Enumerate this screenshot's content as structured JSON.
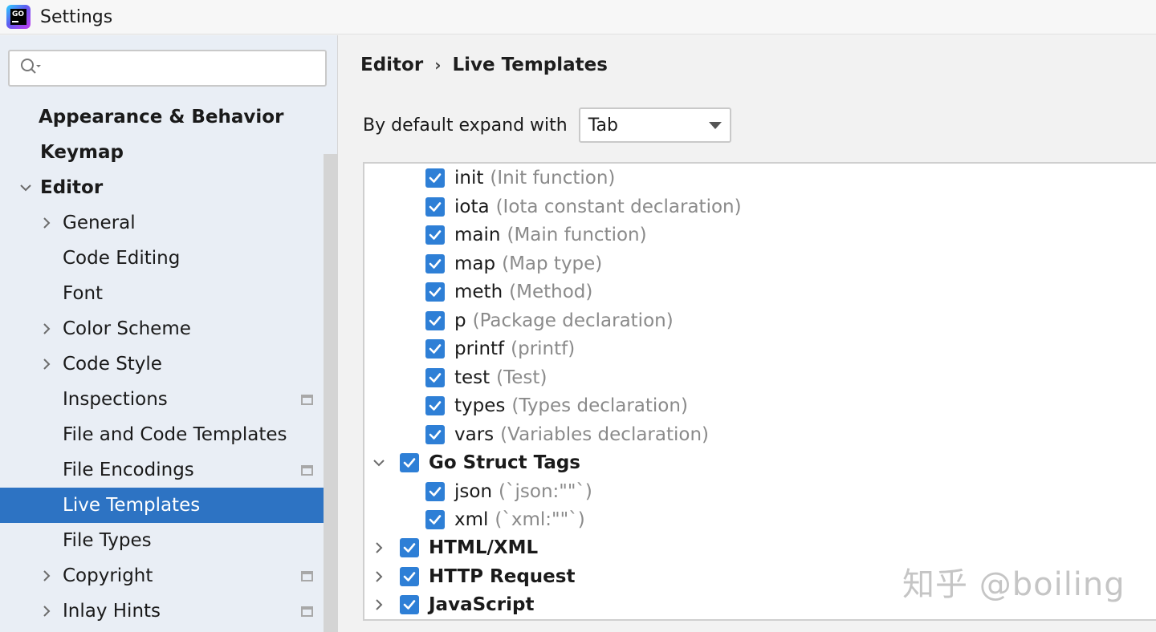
{
  "window": {
    "title": "Settings"
  },
  "search": {
    "placeholder": "",
    "value": ""
  },
  "sidebar": {
    "items": [
      {
        "label": "Appearance & Behavior",
        "bold": true,
        "indent": 0,
        "chevron": "none",
        "badge": false,
        "selected": false
      },
      {
        "label": "Keymap",
        "bold": true,
        "indent": 0,
        "chevron": "none",
        "badge": false,
        "selected": false
      },
      {
        "label": "Editor",
        "bold": true,
        "indent": 0,
        "chevron": "down",
        "badge": false,
        "selected": false
      },
      {
        "label": "General",
        "bold": false,
        "indent": 1,
        "chevron": "right",
        "badge": false,
        "selected": false
      },
      {
        "label": "Code Editing",
        "bold": false,
        "indent": 1,
        "chevron": "none",
        "badge": false,
        "selected": false
      },
      {
        "label": "Font",
        "bold": false,
        "indent": 1,
        "chevron": "none",
        "badge": false,
        "selected": false
      },
      {
        "label": "Color Scheme",
        "bold": false,
        "indent": 1,
        "chevron": "right",
        "badge": false,
        "selected": false
      },
      {
        "label": "Code Style",
        "bold": false,
        "indent": 1,
        "chevron": "right",
        "badge": false,
        "selected": false
      },
      {
        "label": "Inspections",
        "bold": false,
        "indent": 1,
        "chevron": "none",
        "badge": true,
        "selected": false
      },
      {
        "label": "File and Code Templates",
        "bold": false,
        "indent": 1,
        "chevron": "none",
        "badge": false,
        "selected": false
      },
      {
        "label": "File Encodings",
        "bold": false,
        "indent": 1,
        "chevron": "none",
        "badge": true,
        "selected": false
      },
      {
        "label": "Live Templates",
        "bold": false,
        "indent": 1,
        "chevron": "none",
        "badge": false,
        "selected": true
      },
      {
        "label": "File Types",
        "bold": false,
        "indent": 1,
        "chevron": "none",
        "badge": false,
        "selected": false
      },
      {
        "label": "Copyright",
        "bold": false,
        "indent": 1,
        "chevron": "right",
        "badge": true,
        "selected": false
      },
      {
        "label": "Inlay Hints",
        "bold": false,
        "indent": 1,
        "chevron": "right",
        "badge": true,
        "selected": false
      }
    ]
  },
  "breadcrumb": {
    "parent": "Editor",
    "separator": "›",
    "current": "Live Templates"
  },
  "expand": {
    "label": "By default expand with",
    "selected": "Tab"
  },
  "templates": [
    {
      "abbr": "init",
      "desc": "(Init function)",
      "checked": true,
      "group": false,
      "chevron": "none"
    },
    {
      "abbr": "iota",
      "desc": "(Iota constant declaration)",
      "checked": true,
      "group": false,
      "chevron": "none"
    },
    {
      "abbr": "main",
      "desc": "(Main function)",
      "checked": true,
      "group": false,
      "chevron": "none"
    },
    {
      "abbr": "map",
      "desc": "(Map type)",
      "checked": true,
      "group": false,
      "chevron": "none"
    },
    {
      "abbr": "meth",
      "desc": "(Method)",
      "checked": true,
      "group": false,
      "chevron": "none"
    },
    {
      "abbr": "p",
      "desc": "(Package declaration)",
      "checked": true,
      "group": false,
      "chevron": "none"
    },
    {
      "abbr": "printf",
      "desc": "(printf)",
      "checked": true,
      "group": false,
      "chevron": "none"
    },
    {
      "abbr": "test",
      "desc": "(Test)",
      "checked": true,
      "group": false,
      "chevron": "none"
    },
    {
      "abbr": "types",
      "desc": "(Types declaration)",
      "checked": true,
      "group": false,
      "chevron": "none"
    },
    {
      "abbr": "vars",
      "desc": "(Variables declaration)",
      "checked": true,
      "group": false,
      "chevron": "none"
    },
    {
      "abbr": "Go Struct Tags",
      "desc": "",
      "checked": true,
      "group": true,
      "chevron": "down"
    },
    {
      "abbr": "json",
      "desc": "(`json:\"\"`)",
      "checked": true,
      "group": false,
      "chevron": "none"
    },
    {
      "abbr": "xml",
      "desc": "(`xml:\"\"`)",
      "checked": true,
      "group": false,
      "chevron": "none"
    },
    {
      "abbr": "HTML/XML",
      "desc": "",
      "checked": true,
      "group": true,
      "chevron": "right"
    },
    {
      "abbr": "HTTP Request",
      "desc": "",
      "checked": true,
      "group": true,
      "chevron": "right"
    },
    {
      "abbr": "JavaScript",
      "desc": "",
      "checked": true,
      "group": true,
      "chevron": "right"
    }
  ],
  "watermark": "知乎 @boiling",
  "colors": {
    "selection": "#2d73c3",
    "checkbox": "#2e7fd6"
  }
}
